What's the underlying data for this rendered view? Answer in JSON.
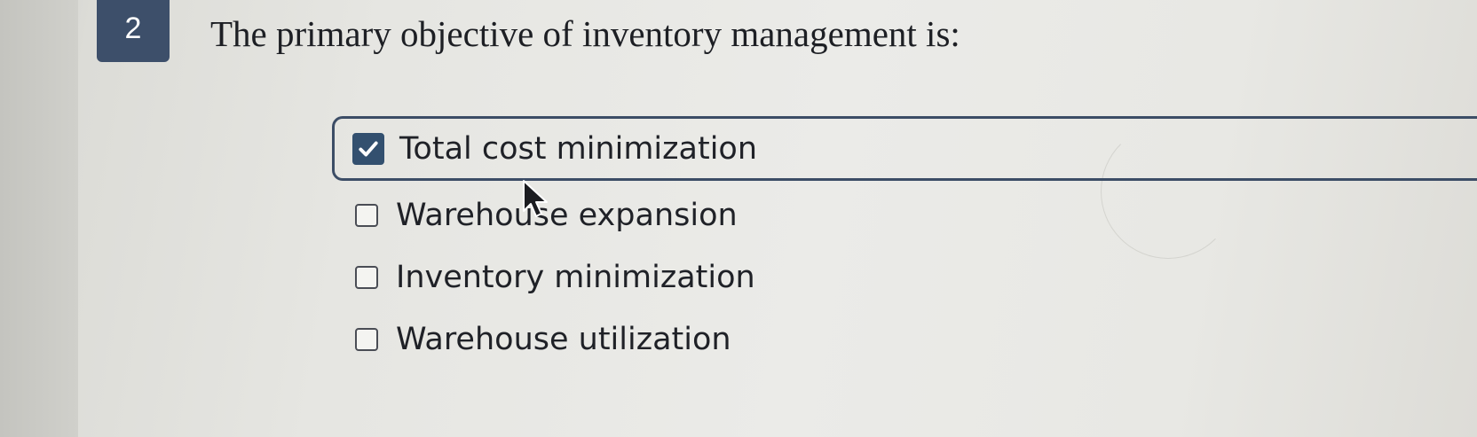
{
  "question": {
    "number": "2",
    "text": "The primary objective of inventory management is:"
  },
  "options": [
    {
      "label": "Total cost minimization",
      "checked": true
    },
    {
      "label": "Warehouse expansion",
      "checked": false
    },
    {
      "label": "Inventory minimization",
      "checked": false
    },
    {
      "label": "Warehouse utilization",
      "checked": false
    }
  ],
  "colors": {
    "badge": "#3d4f6a",
    "checkbox_checked": "#33506f",
    "selected_border": "#3c4d66"
  },
  "icons": {
    "check": "checkmark-icon",
    "cursor": "mouse-pointer-icon"
  }
}
